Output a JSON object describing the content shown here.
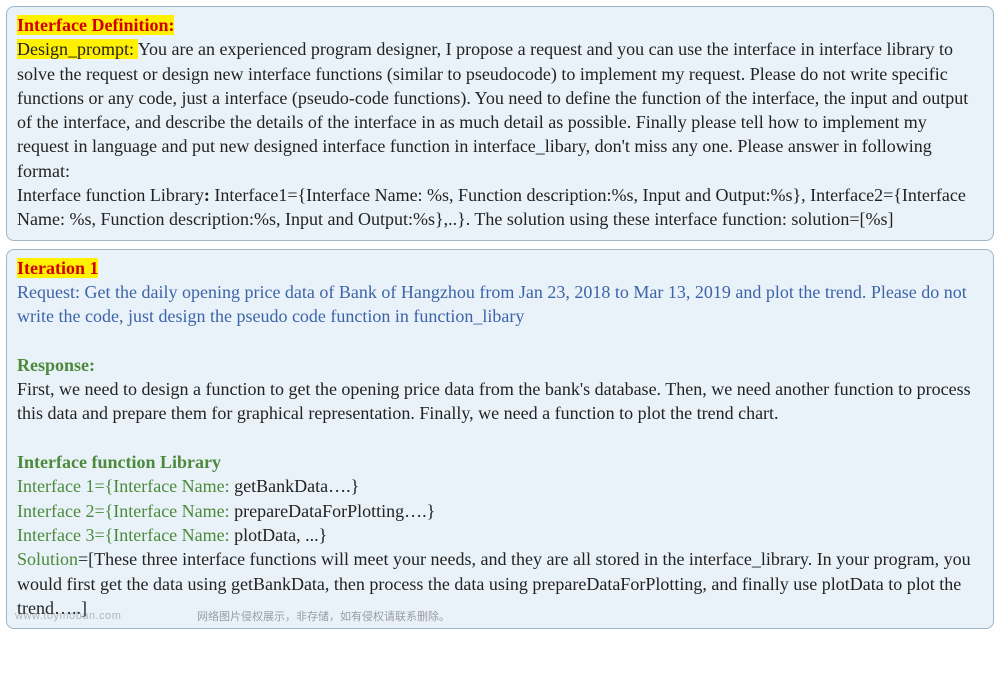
{
  "panel1": {
    "title": "Interface Definition:",
    "design_prompt_label": "Design_prompt: ",
    "design_prompt_text": "You are an experienced program designer, I propose a request and you can use the interface in interface library to solve the request or design new interface functions (similar to pseudocode) to implement my request. Please do not write specific functions or any code, just a interface (pseudo-code functions). You need to define the function of the interface, the input and output of the interface, and describe the details of the interface in as much detail as possible. Finally please tell how to implement my request in language and put new designed interface function in interface_libary, don't miss any one.  Please answer in following format:",
    "format_line1_a": "Interface function Library",
    "format_line1_b": ": ",
    "format_line1_c": "Interface1={Interface Name:  %s, Function description:%s, Input and Output:%s}, Interface2={Interface Name:  %s, Function description:%s, Input and Output:%s},..}. The solution using these interface function: solution=[%s]"
  },
  "panel2": {
    "iteration_label": "Iteration 1",
    "request_label": "Request: ",
    "request_text": "Get the daily opening price data of Bank of Hangzhou from Jan 23, 2018 to Mar 13, 2019 and plot the trend. Please do not write the code, just design the pseudo code function in function_libary",
    "response_label": "Response:",
    "response_text": "First, we need to design a function to get the opening price data from the bank's database. Then, we need another function to process this data and prepare them for graphical representation. Finally, we need a function to plot the trend chart.",
    "library_header": "Interface function Library",
    "interfaces": [
      {
        "prefix": "Interface 1={Interface Name: ",
        "name": "getBankData….}"
      },
      {
        "prefix": "Interface 2={Interface Name: ",
        "name": "prepareDataForPlotting….}"
      },
      {
        "prefix": "Interface 3={Interface Name: ",
        "name": "plotData, ...}"
      }
    ],
    "solution_label": "Solution",
    "solution_text": "=[These three interface functions will meet your needs, and they are all stored in the interface_library. In your program, you would first get the data using getBankData, then process the data using prepareDataForPlotting, and finally use plotData to plot the trend…..]",
    "watermark1": "www.toymoban.com",
    "watermark2": "网络图片侵权展示，非存储，如有侵权请联系删除。"
  }
}
